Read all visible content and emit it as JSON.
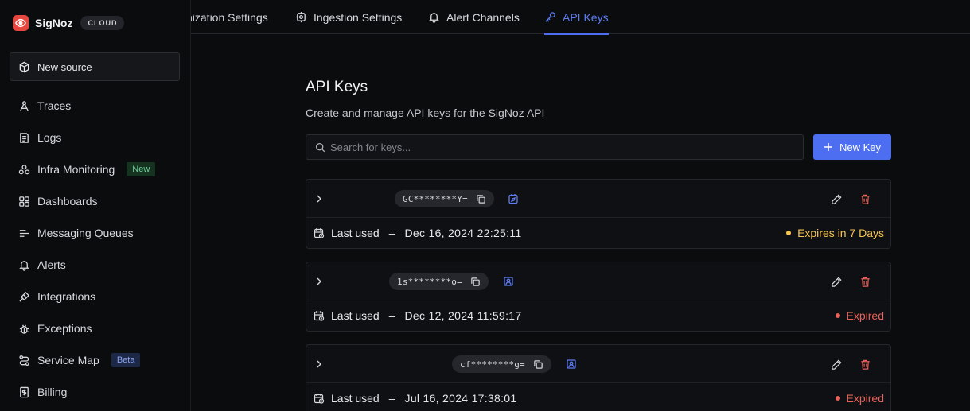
{
  "colors": {
    "accent": "#4e6ef2",
    "expires_soon": "#f5c451",
    "expired": "#e8615a",
    "brand_logo": "#e8473f"
  },
  "brand": {
    "name": "SigNoz",
    "badge": "CLOUD",
    "logo_icon": "eye-icon"
  },
  "sidebar": {
    "new_source": {
      "label": "New source",
      "icon": "cube-icon"
    },
    "items": [
      {
        "label": "Traces",
        "icon": "traces-icon"
      },
      {
        "label": "Logs",
        "icon": "logs-icon"
      },
      {
        "label": "Infra Monitoring",
        "icon": "infra-icon",
        "badge": "New"
      },
      {
        "label": "Dashboards",
        "icon": "dashboard-icon"
      },
      {
        "label": "Messaging Queues",
        "icon": "queue-icon"
      },
      {
        "label": "Alerts",
        "icon": "bell-icon"
      },
      {
        "label": "Integrations",
        "icon": "plug-icon"
      },
      {
        "label": "Exceptions",
        "icon": "bug-icon"
      },
      {
        "label": "Service Map",
        "icon": "route-icon",
        "badge": "Beta"
      },
      {
        "label": "Billing",
        "icon": "billing-icon"
      }
    ]
  },
  "tabs": [
    {
      "label": "nization Settings",
      "icon": ""
    },
    {
      "label": "Ingestion Settings",
      "icon": "gear-icon"
    },
    {
      "label": "Alert Channels",
      "icon": "bell-icon"
    },
    {
      "label": "API Keys",
      "icon": "key-icon",
      "active": true
    }
  ],
  "page": {
    "title": "API Keys",
    "subtitle": "Create and manage API keys for the SigNoz API",
    "search_placeholder": "Search for keys...",
    "new_key_label": "New Key"
  },
  "keys": [
    {
      "masked": "GC********Y=",
      "role": "editor",
      "last_used_label": "Last used",
      "separator": "–",
      "last_used": "Dec 16, 2024 22:25:11",
      "status": "Expires in 7 Days",
      "status_type": "expiring"
    },
    {
      "masked": "1s********o=",
      "role": "admin",
      "last_used_label": "Last used",
      "separator": "–",
      "last_used": "Dec 12, 2024 11:59:17",
      "status": "Expired",
      "status_type": "expired"
    },
    {
      "masked": "cf********g=",
      "role": "admin",
      "last_used_label": "Last used",
      "separator": "–",
      "last_used": "Jul 16, 2024 17:38:01",
      "status": "Expired",
      "status_type": "expired"
    }
  ]
}
